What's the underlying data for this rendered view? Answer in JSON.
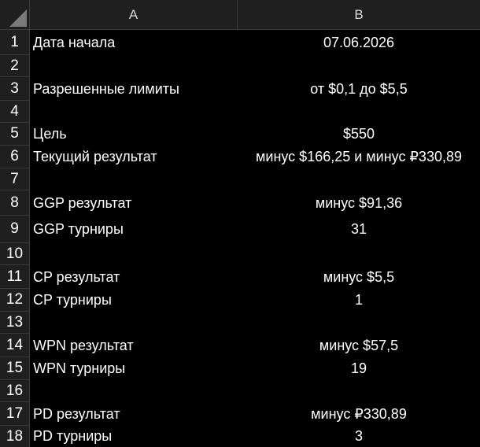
{
  "columns": {
    "a": "A",
    "b": "B"
  },
  "rows": [
    {
      "n": "1",
      "a": "Дата начала",
      "b": "07.06.2026"
    },
    {
      "n": "2",
      "a": "",
      "b": ""
    },
    {
      "n": "3",
      "a": "Разрешенные лимиты",
      "b": "от $0,1 до $5,5"
    },
    {
      "n": "4",
      "a": "",
      "b": ""
    },
    {
      "n": "5",
      "a": "Цель",
      "b": "$550"
    },
    {
      "n": "6",
      "a": "Текущий результат",
      "b": "минус $166,25 и минус ₽330,89"
    },
    {
      "n": "7",
      "a": "",
      "b": ""
    },
    {
      "n": "8",
      "a": "GGP результат",
      "b": "минус $91,36"
    },
    {
      "n": "9",
      "a": "GGP турниры",
      "b": "31"
    },
    {
      "n": "10",
      "a": "",
      "b": ""
    },
    {
      "n": "11",
      "a": "CP результат",
      "b": "минус $5,5"
    },
    {
      "n": "12",
      "a": "CP турниры",
      "b": "1"
    },
    {
      "n": "13",
      "a": "",
      "b": ""
    },
    {
      "n": "14",
      "a": "WPN результат",
      "b": "минус $57,5"
    },
    {
      "n": "15",
      "a": "WPN турниры",
      "b": "19"
    },
    {
      "n": "16",
      "a": "",
      "b": ""
    },
    {
      "n": "17",
      "a": "PD результат",
      "b": "минус ₽330,89"
    },
    {
      "n": "18",
      "a": "PD турниры",
      "b": "3"
    }
  ]
}
